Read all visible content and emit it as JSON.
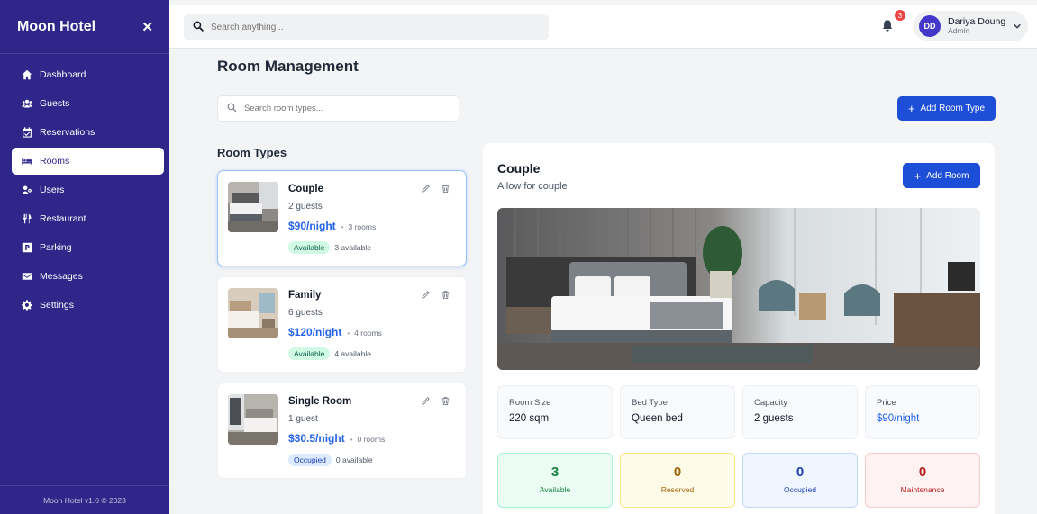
{
  "sidebar": {
    "brand": "Moon Hotel",
    "items": [
      {
        "label": "Dashboard",
        "icon": "home-icon"
      },
      {
        "label": "Guests",
        "icon": "users-icon"
      },
      {
        "label": "Reservations",
        "icon": "calendar-check-icon"
      },
      {
        "label": "Rooms",
        "icon": "bed-icon",
        "active": true
      },
      {
        "label": "Users",
        "icon": "user-group-icon"
      },
      {
        "label": "Restaurant",
        "icon": "utensils-icon"
      },
      {
        "label": "Parking",
        "icon": "parking-icon"
      },
      {
        "label": "Messages",
        "icon": "envelope-icon"
      },
      {
        "label": "Settings",
        "icon": "gear-icon"
      }
    ],
    "footer": "Moon Hotel v1.0 © 2023"
  },
  "topbar": {
    "search_placeholder": "Search anything...",
    "notification_count": "3",
    "user": {
      "initials": "DD",
      "name": "Dariya Doung",
      "role": "Admin"
    }
  },
  "main": {
    "title": "Room Management",
    "search_placeholder": "Search room types...",
    "add_room_type_label": "Add Room Type",
    "room_types_title": "Room Types",
    "room_types": [
      {
        "name": "Couple",
        "guests": "2 guests",
        "price": "$90/night",
        "rooms": "3 rooms",
        "status": "Available",
        "available": "3 available",
        "status_color": "#d1fae5"
      },
      {
        "name": "Family",
        "guests": "6 guests",
        "price": "$120/night",
        "rooms": "4 rooms",
        "status": "Available",
        "available": "4 available",
        "status_color": "#d1fae5"
      },
      {
        "name": "Single Room",
        "guests": "1 guest",
        "price": "$30.5/night",
        "rooms": "0 rooms",
        "status": "Occupied",
        "available": "0 available",
        "status_color": "#dbeafe"
      }
    ]
  },
  "detail": {
    "name": "Couple",
    "description": "Allow for couple",
    "add_room_label": "Add Room",
    "stats": [
      {
        "label": "Room Size",
        "value": "220 sqm"
      },
      {
        "label": "Bed Type",
        "value": "Queen bed"
      },
      {
        "label": "Capacity",
        "value": "2 guests"
      },
      {
        "label": "Price",
        "value": "$90/night"
      }
    ],
    "counts": [
      {
        "value": "3",
        "label": "Available"
      },
      {
        "value": "0",
        "label": "Reserved"
      },
      {
        "value": "0",
        "label": "Occupied"
      },
      {
        "value": "0",
        "label": "Maintenance"
      }
    ]
  },
  "colors": {
    "sidebar_bg": "#2e2689",
    "primary": "#1d4ed8",
    "price": "#2563eb"
  }
}
